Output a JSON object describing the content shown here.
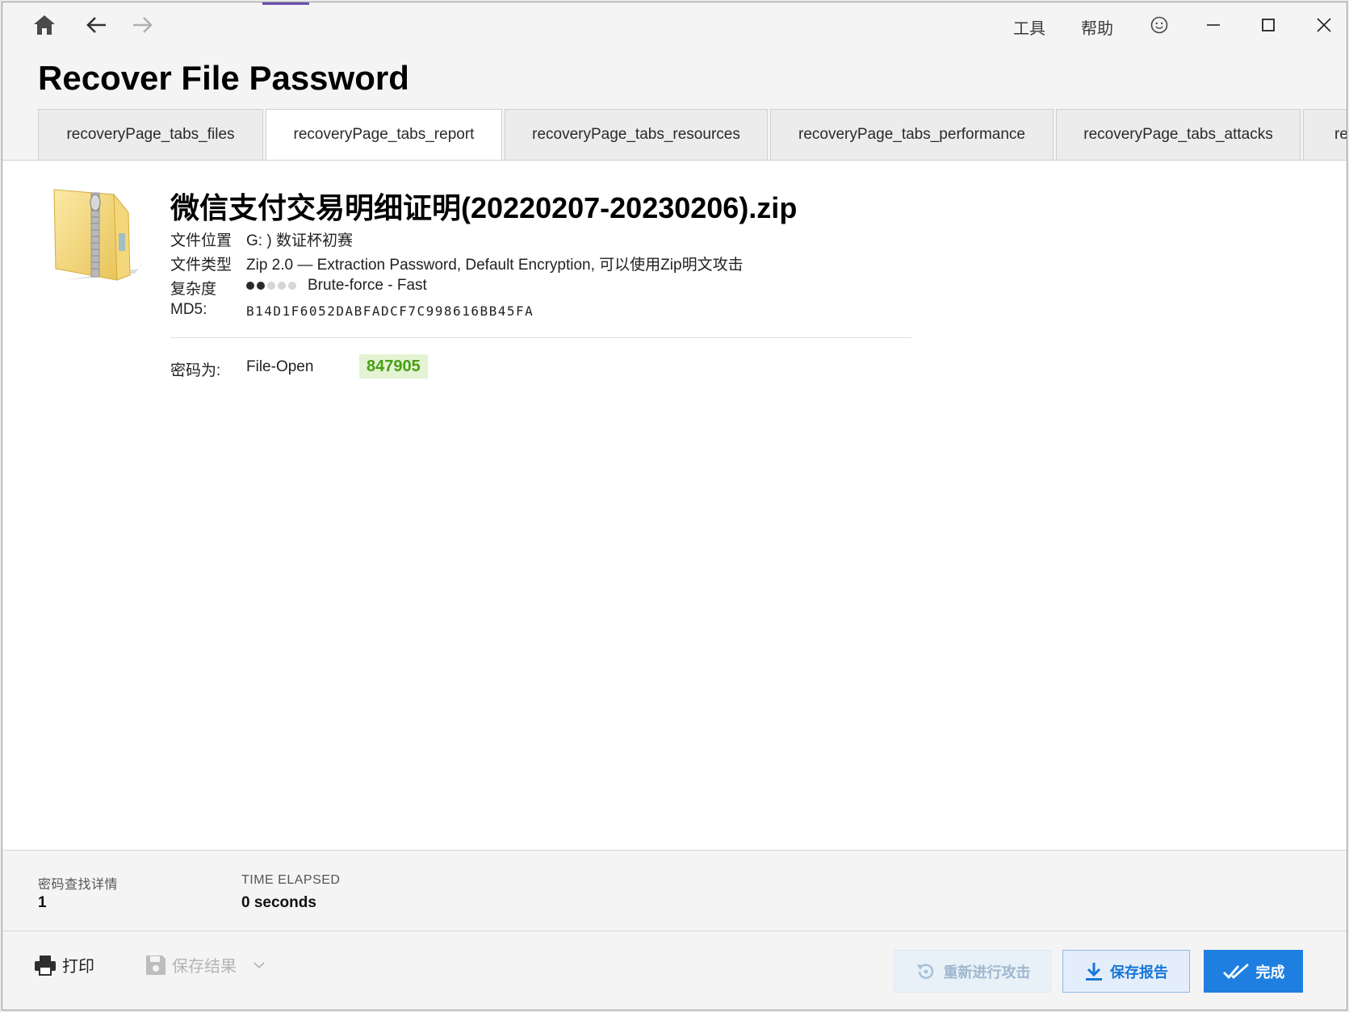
{
  "titlebar": {
    "tools_label": "工具",
    "help_label": "帮助"
  },
  "page": {
    "title": "Recover File Password"
  },
  "tabs": [
    {
      "label": "recoveryPage_tabs_files",
      "active": false
    },
    {
      "label": "recoveryPage_tabs_report",
      "active": true
    },
    {
      "label": "recoveryPage_tabs_resources",
      "active": false
    },
    {
      "label": "recoveryPage_tabs_performance",
      "active": false
    },
    {
      "label": "recoveryPage_tabs_attacks",
      "active": false
    },
    {
      "label": "rec",
      "active": false
    }
  ],
  "report": {
    "file_name": "微信支付交易明细证明(20220207-20230206).zip",
    "location_label": "文件位置",
    "location_value": "G: ) 数证杯初赛",
    "type_label": "文件类型",
    "type_value": "Zip 2.0 — Extraction Password, Default Encryption, 可以使用Zip明文攻击",
    "complexity_label": "复杂度",
    "complexity_level": 2,
    "complexity_max": 5,
    "complexity_value": "Brute-force - Fast",
    "md5_label": "MD5:",
    "md5_value": "B14D1F6052DABFADCF7C998616BB45FA",
    "password_label": "密码为:",
    "password_type": "File-Open",
    "password_value": "847905"
  },
  "stats": {
    "found_label": "密码查找详情",
    "found_value": "1",
    "time_label": "TIME ELAPSED",
    "time_value": "0 seconds"
  },
  "footer": {
    "print_label": "打印",
    "save_result_label": "保存结果",
    "retry_label": "重新进行攻击",
    "save_report_label": "保存报告",
    "done_label": "完成"
  },
  "colors": {
    "accent_blue": "#1e7fe0",
    "password_green": "#48a014",
    "password_bg": "#e3f3d3",
    "titlebar_strip": "#6b4fb0"
  }
}
